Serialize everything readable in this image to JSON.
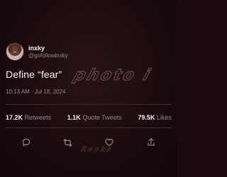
{
  "tweet": {
    "display_name": "inxky",
    "handle": "@gofollowinxky",
    "text": "Define “fear”",
    "timestamp": "10:13 AM · Jul 18, 2024"
  },
  "stats": {
    "retweets_count": "17.2K",
    "retweets_label": "Retweets",
    "quotes_count": "1.1K",
    "quotes_label": "Quote Tweets",
    "likes_count": "79.5K",
    "likes_label": "Likes"
  },
  "actions": [
    {
      "icon": "reply-icon"
    },
    {
      "icon": "retweet-icon"
    },
    {
      "icon": "like-icon"
    },
    {
      "icon": "share-icon"
    }
  ],
  "watermark": {
    "text": "photo i",
    "small_text": "Ranks"
  },
  "colors": {
    "background": "#1b0b0e",
    "primary_text": "#f4f4f4",
    "secondary_text": "#8e8a8b",
    "divider": "#3a2a2d"
  }
}
